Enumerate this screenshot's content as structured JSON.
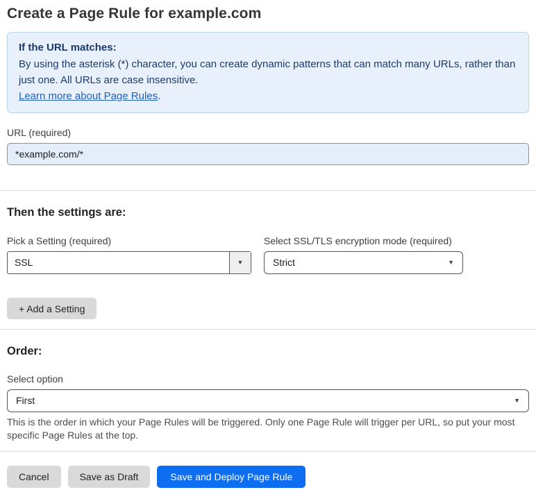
{
  "page": {
    "title": "Create a Page Rule for example.com"
  },
  "info_box": {
    "heading": "If the URL matches:",
    "body": "By using the asterisk (*) character, you can create dynamic patterns that can match many URLs, rather than just one. All URLs are case insensitive.",
    "link_label": "Learn more about Page Rules",
    "link_suffix": "."
  },
  "url_field": {
    "label": "URL (required)",
    "value": "*example.com/*"
  },
  "settings_section": {
    "heading": "Then the settings are:",
    "setting_picker": {
      "label": "Pick a Setting (required)",
      "value": "SSL"
    },
    "mode_picker": {
      "label": "Select SSL/TLS encryption mode (required)",
      "value": "Strict"
    },
    "add_button_label": "+ Add a Setting"
  },
  "order_section": {
    "heading": "Order:",
    "select_label": "Select option",
    "value": "First",
    "help_text": "This is the order in which your Page Rules will be triggered. Only one Page Rule will trigger per URL, so put your most specific Page Rules at the top."
  },
  "footer": {
    "cancel_label": "Cancel",
    "save_draft_label": "Save as Draft",
    "save_deploy_label": "Save and Deploy Page Rule"
  },
  "icons": {
    "dropdown_arrow": "▼"
  },
  "colors": {
    "primary_button": "#0d6ef2",
    "info_background": "#e8f1fb",
    "info_border": "#b9d5ee",
    "info_text": "#1c3a69",
    "link_blue": "#1f5fc4",
    "url_input_background": "#e4eefb",
    "gray_button": "#d9d9d9",
    "control_border": "#55565a",
    "divider": "#dcdcdc"
  }
}
